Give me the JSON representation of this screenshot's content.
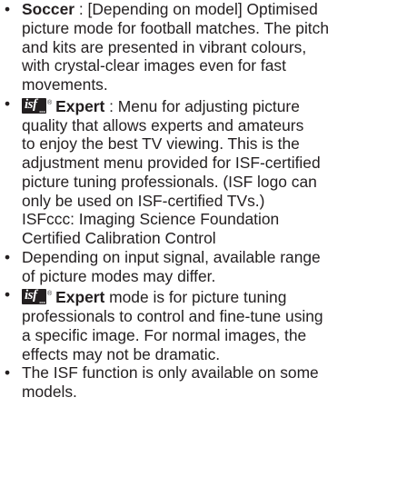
{
  "bullet_char": "•",
  "logo": {
    "main": "isf",
    "sub": "ccc",
    "tm": "®"
  },
  "items": [
    {
      "label": "Soccer",
      "lines": [
        " : [Depending on model] Optimised",
        "picture mode for football matches. The pitch",
        "and kits are presented in vibrant colours,",
        "with crystal-clear images even for fast",
        "movements."
      ]
    },
    {
      "label": "Expert",
      "lines": [
        " : Menu for adjusting picture",
        "quality that allows experts and amateurs",
        "to enjoy the best TV viewing. This is the",
        "adjustment menu provided for ISF-certified",
        "picture tuning professionals. (ISF logo can",
        "only be used on ISF-certified TVs.)",
        "ISFccc: Imaging Science Foundation",
        "Certified Calibration Control"
      ]
    },
    {
      "lines": [
        "Depending on input signal, available range",
        "of picture modes may differ."
      ]
    },
    {
      "label": "Expert",
      "lines": [
        " mode is for picture tuning",
        "professionals to control and fine-tune using",
        "a specific image. For normal images, the",
        "effects may not be dramatic."
      ]
    },
    {
      "lines": [
        "The ISF function is only available on some",
        "models."
      ]
    }
  ]
}
